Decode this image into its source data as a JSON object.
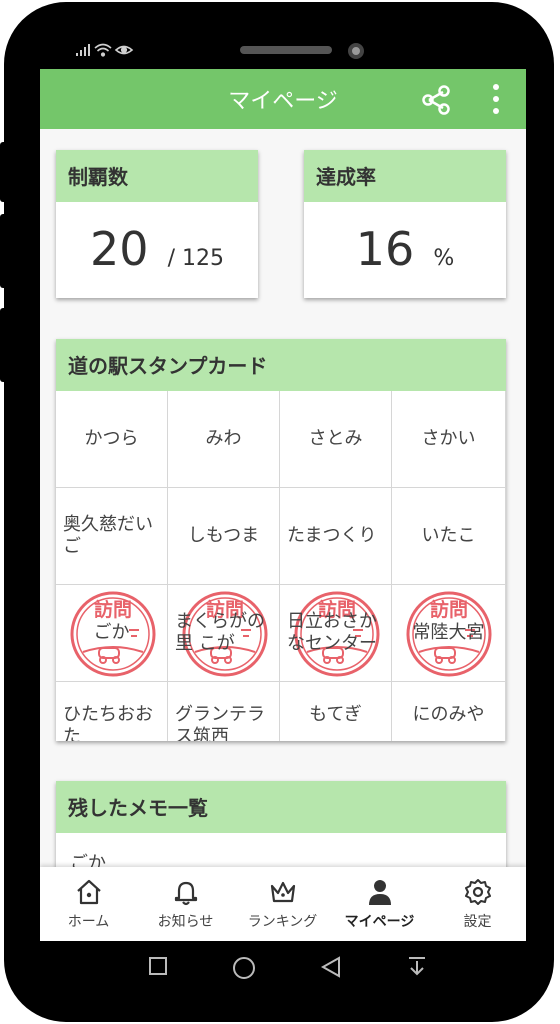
{
  "status_bar": {
    "icons": [
      "signal-icon",
      "wifi-icon",
      "eye-icon"
    ]
  },
  "app_bar": {
    "title": "マイページ",
    "share_icon": "share-icon",
    "more_icon": "more-vert-icon"
  },
  "stats": {
    "conquered": {
      "label": "制覇数",
      "value": "20",
      "total": "/ 125"
    },
    "rate": {
      "label": "達成率",
      "value": "16",
      "unit": "%"
    }
  },
  "stamp_card": {
    "title": "道の駅スタンプカード",
    "stamp_text": "訪問",
    "rows": [
      [
        "かつら",
        "みわ",
        "さとみ",
        "さかい"
      ],
      [
        "奥久慈だいご",
        "しもつま",
        "たまつくり",
        "いたこ"
      ],
      [
        "ごか",
        "まくらがの里 こが",
        "日立おさかなセンター",
        "常陸大宮"
      ],
      [
        "ひたちおおた",
        "グランテラス筑西",
        "もてぎ",
        "にのみや"
      ]
    ],
    "visited": [
      [
        false,
        false,
        false,
        false
      ],
      [
        false,
        false,
        false,
        false
      ],
      [
        true,
        true,
        true,
        true
      ],
      [
        false,
        false,
        false,
        false
      ]
    ]
  },
  "memo": {
    "title": "残したメモ一覧",
    "first_item": "ごか"
  },
  "bottom_nav": [
    {
      "label": "ホーム",
      "icon": "home-icon",
      "active": false
    },
    {
      "label": "お知らせ",
      "icon": "bell-icon",
      "active": false
    },
    {
      "label": "ランキング",
      "icon": "crown-icon",
      "active": false
    },
    {
      "label": "マイページ",
      "icon": "person-icon",
      "active": true
    },
    {
      "label": "設定",
      "icon": "gear-icon",
      "active": false
    }
  ],
  "colors": {
    "accent": "#74c66a",
    "header_light": "#b6e6ac",
    "stamp": "#e8626a"
  }
}
